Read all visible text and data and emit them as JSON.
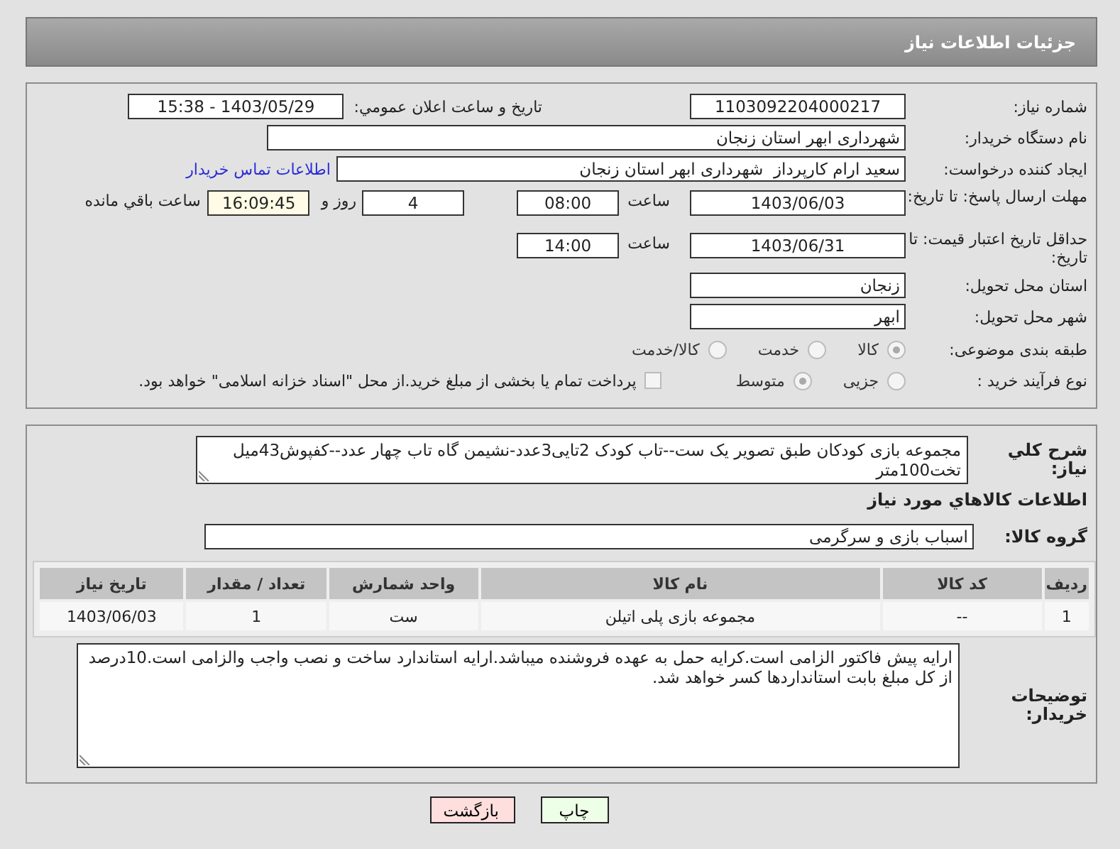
{
  "header": {
    "title": "جزئیات اطلاعات نیاز"
  },
  "details": {
    "need_number": {
      "label": "شماره نیاز:",
      "value": "1103092204000217"
    },
    "announce": {
      "label": "تاریخ و ساعت اعلان عمومي:",
      "value": "1403/05/29 - 15:38"
    },
    "buyer": {
      "label": "نام دستگاه خریدار:",
      "value": "شهرداری ابهر استان زنجان"
    },
    "creator": {
      "label": "ایجاد کننده درخواست:",
      "value": "سعید ارام کارپرداز  شهرداری ابهر استان زنجان"
    },
    "contact_link": "اطلاعات تماس خریدار",
    "deadline": {
      "label": "مهلت ارسال پاسخ: تا تاریخ:",
      "date": "1403/06/03",
      "time_label": "ساعت",
      "time": "08:00",
      "days": "4",
      "days_label": "روز و",
      "remaining": "16:09:45",
      "remaining_label": "ساعت باقي مانده"
    },
    "validity": {
      "label": "حداقل تاریخ اعتبار قیمت: تا تاریخ:",
      "date": "1403/06/31",
      "time_label": "ساعت",
      "time": "14:00"
    },
    "province": {
      "label": "استان محل تحویل:",
      "value": "زنجان"
    },
    "city": {
      "label": "شهر محل تحویل:",
      "value": "ابهر"
    },
    "category": {
      "label": "طبقه بندی موضوعی:",
      "options": [
        {
          "label": "کالا",
          "selected": true
        },
        {
          "label": "خدمت",
          "selected": false
        },
        {
          "label": "کالا/خدمت",
          "selected": false
        }
      ]
    },
    "process": {
      "label": "نوع فرآیند خرید :",
      "options": [
        {
          "label": "جزیی",
          "selected": false
        },
        {
          "label": "متوسط",
          "selected": true
        }
      ],
      "treasury": {
        "label": "پرداخت تمام یا بخشی از مبلغ خرید.از محل \"اسناد خزانه اسلامی\" خواهد بود.",
        "checked": false
      }
    }
  },
  "need": {
    "description": {
      "label": "شرح کلي نیاز:",
      "value": "مجموعه بازی کودکان طبق تصویر یک ست--تاب کودک 2تایی3عدد-نشیمن گاه تاب چهار عدد--کفپوش43میل تخت100متر"
    },
    "goods_title": "اطلاعات کالاهاي مورد نیاز",
    "group": {
      "label": "گروه کالا:",
      "value": "اسباب بازی و سرگرمی"
    },
    "table": {
      "columns": [
        "ردیف",
        "کد کالا",
        "نام کالا",
        "واحد شمارش",
        "تعداد / مقدار",
        "تاریخ نیاز"
      ],
      "rows": [
        [
          "1",
          "--",
          "مجموعه بازی پلی اتیلن",
          "ست",
          "1",
          "1403/06/03"
        ]
      ]
    },
    "buyer_notes": {
      "label": "توضیحات خریدار:",
      "value": "ارایه پیش فاکتور الزامی است.کرایه حمل به عهده فروشنده میباشد.ارایه استاندارد ساخت و نصب واجب والزامی است.10درصد از کل مبلغ بابت استانداردها کسر خواهد شد."
    }
  },
  "buttons": [
    {
      "label": "چاپ",
      "kind": "print"
    },
    {
      "label": "بازگشت",
      "kind": "back"
    }
  ]
}
